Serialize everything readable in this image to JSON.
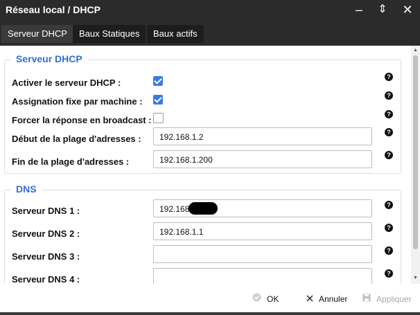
{
  "window": {
    "title": "Réseau local / DHCP",
    "controls": {
      "minimize": "–",
      "restore": "⇕",
      "close": "✕"
    }
  },
  "tabs": [
    {
      "label": "Serveur DHCP",
      "active": true
    },
    {
      "label": "Baux Statiques",
      "active": false
    },
    {
      "label": "Baux actifs",
      "active": false
    }
  ],
  "dhcp_section": {
    "legend": "Serveur DHCP",
    "enable_label": "Activer le serveur DHCP :",
    "enable_checked": true,
    "fixed_label": "Assignation fixe par machine :",
    "fixed_checked": true,
    "broadcast_label": "Forcer la réponse en broadcast :",
    "broadcast_checked": false,
    "start_label": "Début de la plage d'adresses :",
    "start_value": "192.168.1.2",
    "end_label": "Fin de la plage d'adresses :",
    "end_value": "192.168.1.200"
  },
  "dns_section": {
    "legend": "DNS",
    "dns1_label": "Serveur DNS 1 :",
    "dns1_value": "192.168",
    "dns2_label": "Serveur DNS 2 :",
    "dns2_value": "192.168.1.1",
    "dns3_label": "Serveur DNS 3 :",
    "dns3_value": "",
    "dns4_label": "Serveur DNS 4 :",
    "dns4_value": ""
  },
  "help_glyph": "?",
  "footer": {
    "ok_label": "OK",
    "cancel_label": "Annuler",
    "apply_label": "Appliquer"
  }
}
